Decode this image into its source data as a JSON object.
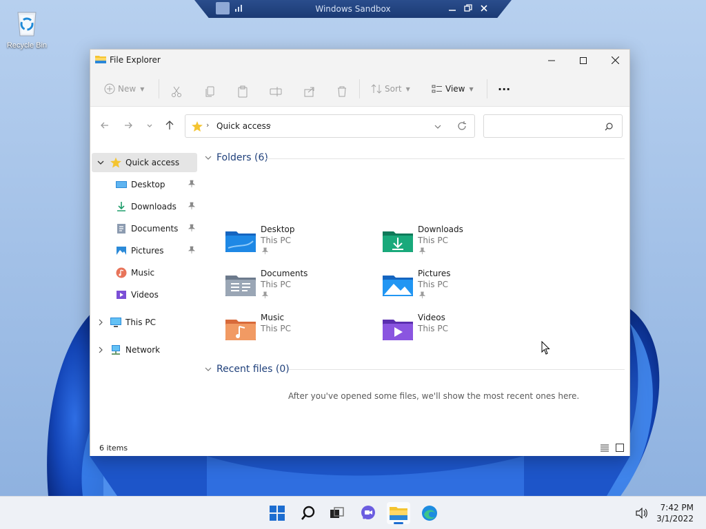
{
  "sandbox": {
    "title": "Windows Sandbox"
  },
  "desktop": {
    "recycle_bin_label": "Recycle Bin"
  },
  "window": {
    "title": "File Explorer"
  },
  "toolbar": {
    "new_label": "New",
    "sort_label": "Sort",
    "view_label": "View",
    "more_label": "···"
  },
  "address": {
    "location": "Quick access"
  },
  "search": {
    "placeholder": ""
  },
  "sidebar": {
    "quick_access": "Quick access",
    "items": [
      {
        "label": "Desktop",
        "icon": "desktop-icon"
      },
      {
        "label": "Downloads",
        "icon": "downloads-icon"
      },
      {
        "label": "Documents",
        "icon": "documents-icon"
      },
      {
        "label": "Pictures",
        "icon": "pictures-icon"
      },
      {
        "label": "Music",
        "icon": "music-icon"
      },
      {
        "label": "Videos",
        "icon": "videos-icon"
      }
    ],
    "this_pc": "This PC",
    "network": "Network"
  },
  "folders": {
    "heading": "Folders (6)",
    "items": [
      {
        "name": "Desktop",
        "location": "This PC"
      },
      {
        "name": "Downloads",
        "location": "This PC"
      },
      {
        "name": "Documents",
        "location": "This PC"
      },
      {
        "name": "Pictures",
        "location": "This PC"
      },
      {
        "name": "Music",
        "location": "This PC"
      },
      {
        "name": "Videos",
        "location": "This PC"
      }
    ]
  },
  "recent": {
    "heading": "Recent files (0)",
    "empty_message": "After you've opened some files, we'll show the most recent ones here."
  },
  "status": {
    "item_count": "6 items"
  },
  "taskbar": {
    "time": "7:42 PM",
    "date": "3/1/2022"
  },
  "colors": {
    "accent": "#1c6dd0",
    "folder_yellow": "#f4c430",
    "wallpaper": "#a9c5e8"
  }
}
